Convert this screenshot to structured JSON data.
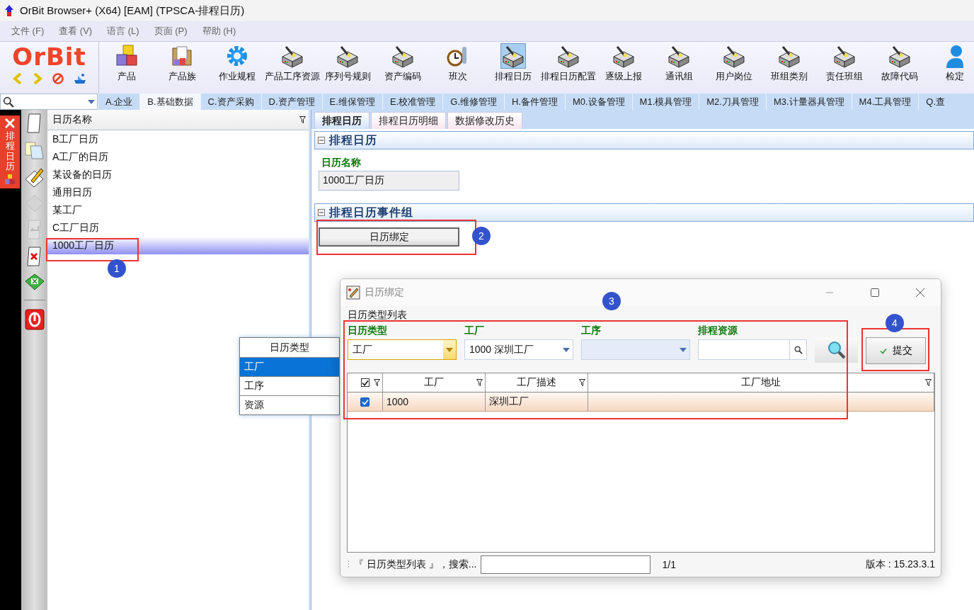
{
  "window": {
    "title": "OrBit Browser+ (X64) [EAM] (TPSCA-排程日历)"
  },
  "menu": [
    "文件 (F)",
    "查看 (V)",
    "语言 (L)",
    "页面 (P)",
    "帮助 (H)"
  ],
  "logo": "OrBit",
  "toolbar": [
    {
      "label": "产品",
      "selected": false
    },
    {
      "label": "产品族",
      "selected": false
    },
    {
      "label": "作业规程",
      "selected": false
    },
    {
      "label": "产品工序资源",
      "selected": false
    },
    {
      "label": "序列号规则",
      "selected": false
    },
    {
      "label": "资产编码",
      "selected": false
    },
    {
      "label": "班次",
      "selected": false
    },
    {
      "label": "排程日历",
      "selected": true
    },
    {
      "label": "排程日历配置",
      "selected": false
    },
    {
      "label": "逐级上报",
      "selected": false
    },
    {
      "label": "通讯组",
      "selected": false
    },
    {
      "label": "用户岗位",
      "selected": false
    },
    {
      "label": "班组类别",
      "selected": false
    },
    {
      "label": "责任班组",
      "selected": false
    },
    {
      "label": "故障代码",
      "selected": false
    },
    {
      "label": "检定",
      "selected": false
    }
  ],
  "module_tabs": [
    {
      "label": "A.企业",
      "selected": false
    },
    {
      "label": "B.基础数据",
      "selected": true
    },
    {
      "label": "C.资产采购",
      "selected": false
    },
    {
      "label": "D.资产管理",
      "selected": false
    },
    {
      "label": "E.维保管理",
      "selected": false
    },
    {
      "label": "E.校准管理",
      "selected": false
    },
    {
      "label": "G.维修管理",
      "selected": false
    },
    {
      "label": "H.备件管理",
      "selected": false
    },
    {
      "label": "M0.设备管理",
      "selected": false
    },
    {
      "label": "M1.模具管理",
      "selected": false
    },
    {
      "label": "M2.刀具管理",
      "selected": false
    },
    {
      "label": "M3.计量器具管理",
      "selected": false
    },
    {
      "label": "M4.工具管理",
      "selected": false
    },
    {
      "label": "Q.查",
      "selected": false
    }
  ],
  "side_tab": {
    "title": "排程日历"
  },
  "list": {
    "column": "日历名称",
    "rows": [
      {
        "label": "B工厂日历",
        "selected": false
      },
      {
        "label": "A工厂的日历",
        "selected": false
      },
      {
        "label": "某设备的日历",
        "selected": false
      },
      {
        "label": "通用日历",
        "selected": false
      },
      {
        "label": "某工厂",
        "selected": false
      },
      {
        "label": "C工厂日历",
        "selected": false
      },
      {
        "label": "1000工厂日历",
        "selected": true
      }
    ]
  },
  "detail_tabs": [
    {
      "label": "排程日历",
      "selected": true
    },
    {
      "label": "排程日历明细",
      "selected": false
    },
    {
      "label": "数据修改历史",
      "selected": false
    }
  ],
  "calendar_section": {
    "title": "排程日历",
    "field_label": "日历名称",
    "field_value": "1000工厂日历"
  },
  "event_section": {
    "title": "排程日历事件组",
    "button": "日历绑定"
  },
  "dropdown": {
    "header": "日历类型",
    "options": [
      {
        "label": "工厂",
        "selected": true
      },
      {
        "label": "工序",
        "selected": false
      },
      {
        "label": "资源",
        "selected": false
      }
    ]
  },
  "dialog": {
    "title": "日历绑定",
    "group_label": "日历类型列表",
    "filters": [
      {
        "label": "日历类型",
        "kind": "combo",
        "value": "工厂",
        "focused": true
      },
      {
        "label": "工厂",
        "kind": "combo",
        "value": "1000 深圳工厂",
        "focused": false
      },
      {
        "label": "工序",
        "kind": "combo",
        "focused": false
      },
      {
        "label": "排程资源",
        "kind": "search",
        "focused": false
      }
    ],
    "submit": "提交",
    "table": {
      "header_checked": true,
      "columns": [
        "工厂",
        "工厂描述",
        "工厂地址"
      ],
      "rows": [
        {
          "checked": true,
          "cells": [
            "1000",
            "深圳工厂"
          ]
        }
      ]
    },
    "status": {
      "caption": "『 日历类型列表 』，搜索...",
      "page": "1/1",
      "version": "版本 : 15.23.3.1"
    }
  },
  "annotations": [
    {
      "number": "1"
    },
    {
      "number": "2"
    },
    {
      "number": "3"
    },
    {
      "number": "4"
    }
  ]
}
